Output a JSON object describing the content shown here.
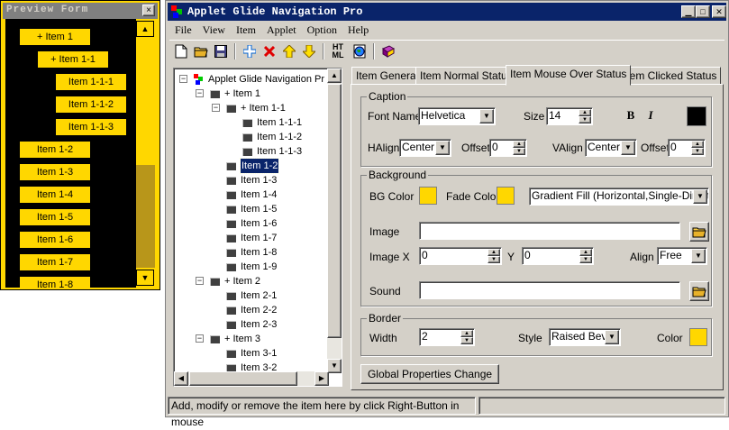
{
  "preview": {
    "title": "Preview Form",
    "close": "×",
    "items": [
      {
        "label": "+ Item 1"
      },
      {
        "label": "+ Item 1-1"
      },
      {
        "label": "Item 1-1-1"
      },
      {
        "label": "Item 1-1-2"
      },
      {
        "label": "Item 1-1-3"
      },
      {
        "label": "Item 1-2"
      },
      {
        "label": "Item 1-3"
      },
      {
        "label": "Item 1-4"
      },
      {
        "label": "Item 1-5"
      },
      {
        "label": "Item 1-6"
      },
      {
        "label": "Item 1-7"
      },
      {
        "label": "Item 1-8"
      }
    ],
    "colors": {
      "item_bg": "#ffd700",
      "menu_bg": "#000000"
    }
  },
  "app": {
    "title": "Applet Glide Navigation Pro",
    "menu": [
      "File",
      "View",
      "Item",
      "Applet",
      "Option",
      "Help"
    ],
    "toolbar": [
      {
        "icon": "new-file-icon",
        "glyph": "🗋"
      },
      {
        "icon": "open-folder-icon",
        "glyph": "📂"
      },
      {
        "icon": "save-icon",
        "glyph": "💾"
      },
      {
        "icon": "add-item-icon",
        "glyph": "✚"
      },
      {
        "icon": "delete-item-icon",
        "glyph": "✖"
      },
      {
        "icon": "move-up-icon",
        "glyph": "⇧"
      },
      {
        "icon": "move-down-icon",
        "glyph": "⇩"
      },
      {
        "icon": "html-export-icon",
        "glyph": "HT\nML"
      },
      {
        "icon": "globe-preview-icon",
        "glyph": "🌐"
      },
      {
        "icon": "help-book-icon",
        "glyph": "📕"
      }
    ]
  },
  "tree": {
    "root": "Applet Glide Navigation Pr",
    "nodes": [
      {
        "label": "+ Item 1",
        "level": 1,
        "expander": "−"
      },
      {
        "label": "+ Item 1-1",
        "level": 2,
        "expander": "−"
      },
      {
        "label": "Item 1-1-1",
        "level": 3
      },
      {
        "label": "Item 1-1-2",
        "level": 3
      },
      {
        "label": "Item 1-1-3",
        "level": 3
      },
      {
        "label": "Item 1-2",
        "level": 2,
        "selected": true
      },
      {
        "label": "Item 1-3",
        "level": 2
      },
      {
        "label": "Item 1-4",
        "level": 2
      },
      {
        "label": "Item 1-5",
        "level": 2
      },
      {
        "label": "Item 1-6",
        "level": 2
      },
      {
        "label": "Item 1-7",
        "level": 2
      },
      {
        "label": "Item 1-8",
        "level": 2
      },
      {
        "label": "Item 1-9",
        "level": 2
      },
      {
        "label": "+ Item 2",
        "level": 1,
        "expander": "−"
      },
      {
        "label": "Item 2-1",
        "level": 2
      },
      {
        "label": "Item 2-2",
        "level": 2
      },
      {
        "label": "Item 2-3",
        "level": 2
      },
      {
        "label": "+ Item 3",
        "level": 1,
        "expander": "−"
      },
      {
        "label": "Item 3-1",
        "level": 2
      },
      {
        "label": "Item 3-2",
        "level": 2
      }
    ]
  },
  "tabs": [
    {
      "label": "Item General"
    },
    {
      "label": "Item Normal Status"
    },
    {
      "label": "Item Mouse Over Status",
      "active": true
    },
    {
      "label": "Item Clicked Status"
    }
  ],
  "caption": {
    "group": "Caption",
    "font_name_label": "Font Name",
    "font_name": "Helvetica",
    "size_label": "Size",
    "size": "14",
    "bold": "B",
    "italic": "I",
    "color": "#000000",
    "halign_label": "HAlign",
    "halign": "Center",
    "offset_label": "Offset",
    "h_offset": "0",
    "valign_label": "VAlign",
    "valign": "Center",
    "v_offset": "0"
  },
  "background": {
    "group": "Background",
    "bg_color_label": "BG Color",
    "bg_color": "#ffd700",
    "fade_color_label": "Fade Color",
    "fade_color": "#ffd700",
    "fill_mode": "Gradient Fill (Horizontal,Single-Directio",
    "image_label": "Image",
    "image": "",
    "imagex_label": "Image X",
    "imagex": "0",
    "y_label": "Y",
    "y": "0",
    "align_label": "Align",
    "align": "Free",
    "sound_label": "Sound",
    "sound": ""
  },
  "border": {
    "group": "Border",
    "width_label": "Width",
    "width": "2",
    "style_label": "Style",
    "style": "Raised Bev",
    "color_label": "Color",
    "color": "#ffd700"
  },
  "global_button": "Global Properties Change",
  "status": "Add, modify or remove the item here by click Right-Button in mouse"
}
